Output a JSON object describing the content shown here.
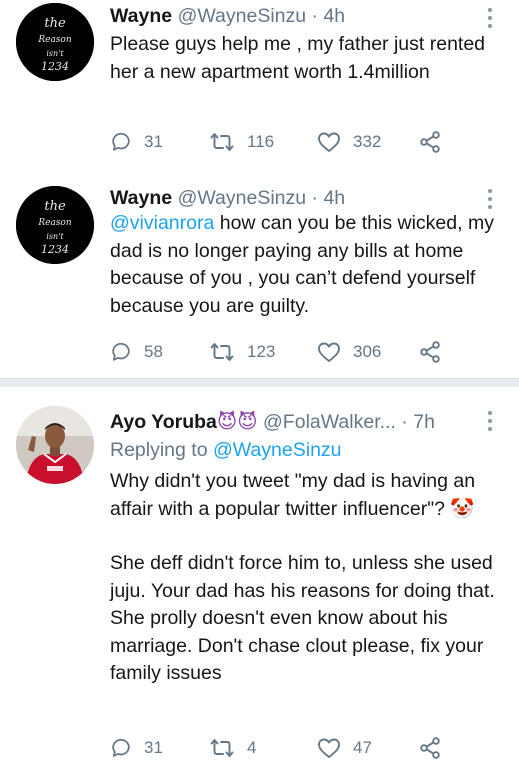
{
  "tweets": [
    {
      "name": "Wayne",
      "handle": "@WayneSinzu",
      "separator": "·",
      "time": "4h",
      "text": "Please guys help me , my father just rented her a new apartment worth 1.4million",
      "replies": "31",
      "retweets": "116",
      "likes": "332",
      "avatar_text": [
        "the",
        "Reason",
        "isn't",
        "1234"
      ]
    },
    {
      "name": "Wayne",
      "handle": "@WayneSinzu",
      "separator": "·",
      "time": "4h",
      "mention": "@vivianrora",
      "text": " how can you be this wicked, my dad is no longer paying any bills at home because of you , you can’t defend yourself because you are guilty.",
      "replies": "58",
      "retweets": "123",
      "likes": "306",
      "avatar_text": [
        "the",
        "Reason",
        "isn't",
        "1234"
      ]
    },
    {
      "name": "Ayo Yoruba",
      "name_emoji": "😈😈",
      "handle": "@FolaWalker...",
      "separator": "·",
      "time": "7h",
      "replying_prefix": "Replying to",
      "replying_to": "@WayneSinzu",
      "paragraph1": "Why didn't you tweet \"my dad is having an affair with a popular twitter influencer\"? 🤡",
      "paragraph2": "She deff didn't force him to, unless she used juju. Your dad has his reasons for doing that. She prolly doesn't even know about his marriage. Don't chase clout please, fix your family issues",
      "replies": "31",
      "retweets": "4",
      "likes": "47"
    }
  ],
  "icons": {
    "reply": "reply-icon",
    "retweet": "retweet-icon",
    "like": "heart-icon",
    "share": "share-icon",
    "more": "more-vertical-icon"
  },
  "colors": {
    "link": "#1da1f2",
    "secondary": "#657786",
    "text": "#14171a",
    "divider": "#e6ecf0"
  }
}
